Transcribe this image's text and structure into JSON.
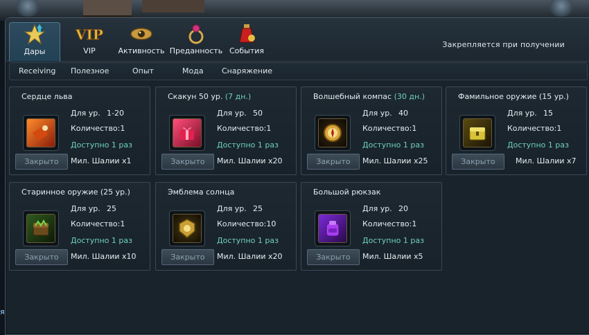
{
  "tabs": [
    {
      "label": "Дары",
      "icon": "star-icon",
      "active": true
    },
    {
      "label": "VIP",
      "icon": "vip-icon",
      "active": false
    },
    {
      "label": "Активность",
      "icon": "eye-icon",
      "active": false
    },
    {
      "label": "Преданность",
      "icon": "ring-icon",
      "active": false
    },
    {
      "label": "События",
      "icon": "potion-icon",
      "active": false
    }
  ],
  "fixed_note": "Закрепляется при получении",
  "sub_tabs": [
    "Receiving",
    "Полезное",
    "Опыт",
    "Мода",
    "Снаряжение"
  ],
  "labels": {
    "level": "Для ур.",
    "quantity": "Количество:",
    "available": "Доступно 1 раз",
    "button": "Закрыто"
  },
  "cards": [
    {
      "name": "Сердце льва",
      "suffix": "",
      "level": "1-20",
      "qty": "1",
      "price": "Мил. Шалии x1",
      "icon": "heart-scroll-icon"
    },
    {
      "name": "Скакун 50 ур.",
      "suffix": "(7 дн.)",
      "level": "50",
      "qty": "1",
      "price": "Мил. Шалии x20",
      "icon": "gift-box-icon"
    },
    {
      "name": "Волшебный компас",
      "suffix": "(30 дн.)",
      "level": "40",
      "qty": "1",
      "price": "Мил. Шалии x25",
      "icon": "compass-icon"
    },
    {
      "name": "Фамильное оружие",
      "suffix": "(15 ур.)",
      "level": "15",
      "qty": "1",
      "price": "Мил. Шалии x7",
      "icon": "weapon-chest-icon"
    },
    {
      "name": "Старинное оружие",
      "suffix": "(25 ур.)",
      "level": "25",
      "qty": "1",
      "price": "Мил. Шалии x10",
      "icon": "green-chest-icon"
    },
    {
      "name": "Эмблема солнца",
      "suffix": "",
      "level": "25",
      "qty": "10",
      "price": "Мил. Шалии x20",
      "icon": "sun-emblem-icon"
    },
    {
      "name": "Большой рюкзак",
      "suffix": "",
      "level": "20",
      "qty": "1",
      "price": "Мил. Шалии x5",
      "icon": "backpack-icon"
    }
  ],
  "side_text": "я"
}
